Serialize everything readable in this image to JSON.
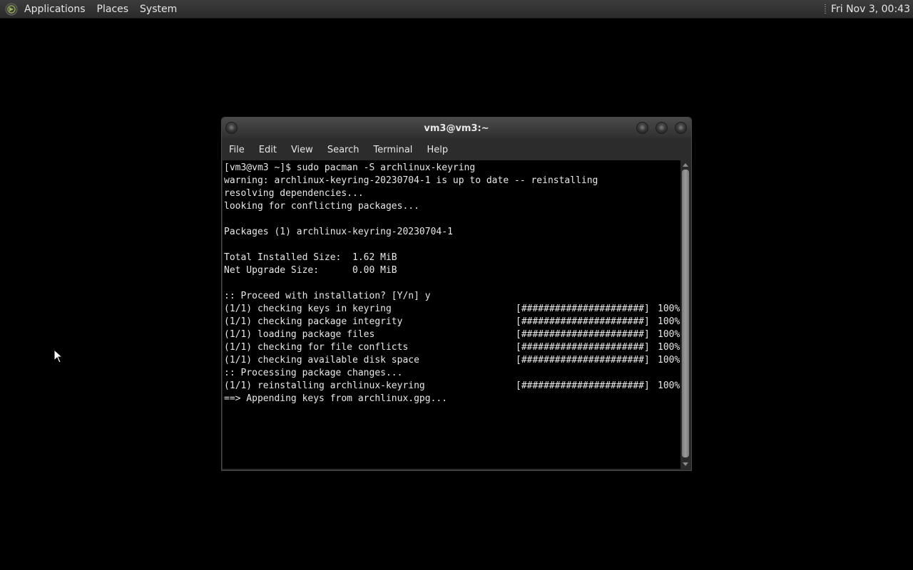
{
  "top_panel": {
    "menus": [
      "Applications",
      "Places",
      "System"
    ],
    "clock": "Fri Nov  3, 00:43"
  },
  "window": {
    "title": "vm3@vm3:~",
    "menubar": [
      "File",
      "Edit",
      "View",
      "Search",
      "Terminal",
      "Help"
    ]
  },
  "terminal": {
    "lines_top": [
      "[vm3@vm3 ~]$ sudo pacman -S archlinux-keyring",
      "warning: archlinux-keyring-20230704-1 is up to date -- reinstalling",
      "resolving dependencies...",
      "looking for conflicting packages...",
      "",
      "Packages (1) archlinux-keyring-20230704-1",
      "",
      "Total Installed Size:  1.62 MiB",
      "Net Upgrade Size:      0.00 MiB",
      "",
      ":: Proceed with installation? [Y/n] y"
    ],
    "progress_a": [
      {
        "label": "(1/1) checking keys in keyring",
        "bar": "[######################]",
        "pct": "100%"
      },
      {
        "label": "(1/1) checking package integrity",
        "bar": "[######################]",
        "pct": "100%"
      },
      {
        "label": "(1/1) loading package files",
        "bar": "[######################]",
        "pct": "100%"
      },
      {
        "label": "(1/1) checking for file conflicts",
        "bar": "[######################]",
        "pct": "100%"
      },
      {
        "label": "(1/1) checking available disk space",
        "bar": "[######################]",
        "pct": "100%"
      }
    ],
    "processing": ":: Processing package changes...",
    "progress_b": [
      {
        "label": "(1/1) reinstalling archlinux-keyring",
        "bar": "[######################]",
        "pct": "100%"
      }
    ],
    "last_line": "==> Appending keys from archlinux.gpg..."
  },
  "colors": {
    "desktop": "#000000",
    "panel": "#2f2f2f",
    "terminal_fg": "#e8e8e8",
    "terminal_bg": "#000000"
  }
}
